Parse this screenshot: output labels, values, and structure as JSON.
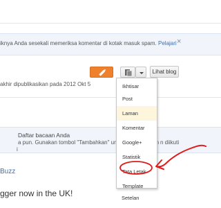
{
  "notice1": {
    "text": "iknya Anda sesekali memeriksa komentar di kotak masuk spam.",
    "link": "Pelajari",
    "close": "×"
  },
  "post_row": {
    "text": "akhir dipublikasikan pada 2012 Okt 5",
    "view_blog": "Lihat blog"
  },
  "menu": {
    "items": [
      "Ikhtisar",
      "Post",
      "Laman",
      "Komentar",
      "Google+",
      "Statistik",
      "Tata Letak",
      "Template",
      "Setelan"
    ],
    "active_index": 2,
    "highlighted_index": 6
  },
  "reading_list": {
    "title": "Daftar bacaan Anda",
    "line2": "a pun. Gunakan tombol \"Tambahkan\" untuk memasukkan",
    "line2_right": "n diikuti",
    "line3": "i"
  },
  "blog_link": "Buzz",
  "headline": "gger now in the UK!",
  "colors": {
    "orange": "#f0812c",
    "annotation_red": "#e01b1b",
    "link": "#3a6fb0"
  }
}
